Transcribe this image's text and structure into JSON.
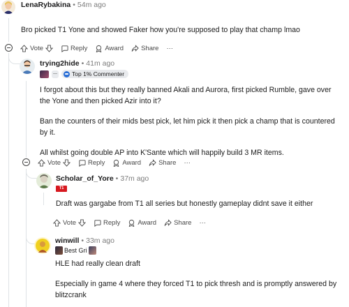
{
  "comments": [
    {
      "author": "LenaRybakina",
      "time": "54m ago",
      "body": [
        "Bro picked T1 Yone and showed Faker how you're supposed to play that champ lmao"
      ],
      "actions": {
        "vote": "Vote",
        "reply": "Reply",
        "award": "Award",
        "share": "Share",
        "more": "···"
      }
    },
    {
      "author": "trying2hide",
      "time": "41m ago",
      "flair_chip": "—",
      "badge": "Top 1% Commenter",
      "body": [
        "I forgot about this but they really banned Akali and Aurora, first picked Rumble, gave over the Yone and then picked Azir into it?",
        "Ban the counters of their mids best pick, let him pick it then pick a champ that is countered by it.",
        "All whilst going double AP into K'Sante which will happily build 3 MR items."
      ],
      "actions": {
        "vote": "Vote",
        "reply": "Reply",
        "award": "Award",
        "share": "Share",
        "more": "···"
      }
    },
    {
      "author": "Scholar_of_Yore",
      "time": "37m ago",
      "team_logo": "T1",
      "body": [
        "Draft was gargabe from T1 all series but honestly gameplay didnt save it either"
      ],
      "actions": {
        "vote": "Vote",
        "reply": "Reply",
        "award": "Award",
        "share": "Share",
        "more": "···"
      }
    },
    {
      "author": "winwill",
      "time": "33m ago",
      "flair_text": "Best Gri",
      "body": [
        "HLE had really clean draft",
        "Especially in game 4 where they forced T1 to pick thresh and is promptly answered by blitzcrank"
      ]
    }
  ],
  "colors": {
    "thread": "#dfe3e6",
    "meta": "#7c7c7c",
    "badge_bg": "#e8eaed",
    "t1_red": "#d71920"
  }
}
